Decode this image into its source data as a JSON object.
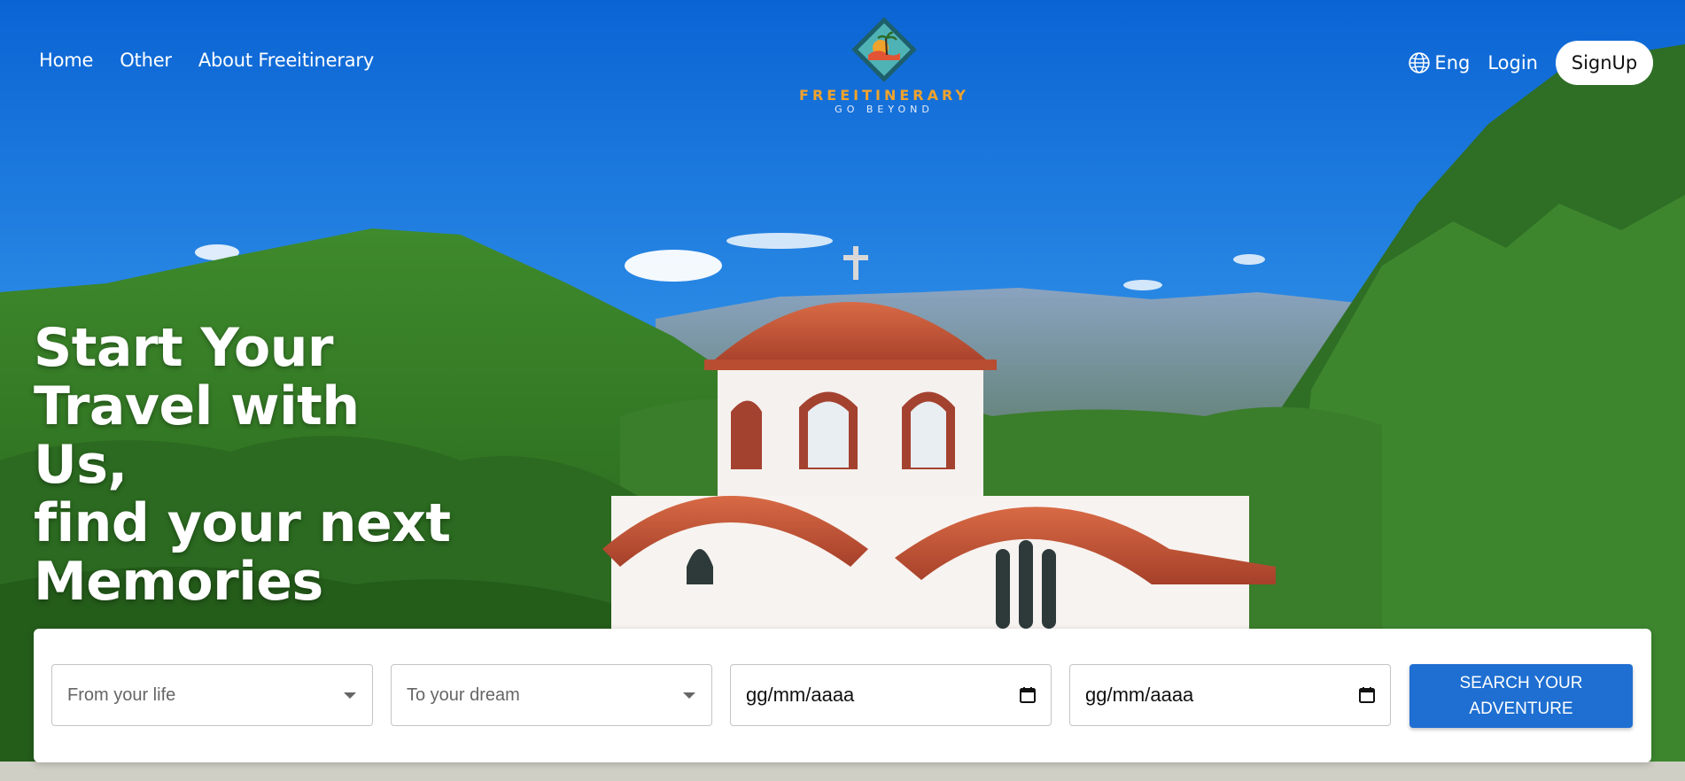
{
  "header": {
    "nav": [
      "Home",
      "Other",
      "About Freeitinerary"
    ],
    "logo": {
      "name": "FREEITINERARY",
      "tagline": "GO BEYOND"
    },
    "language": "Eng",
    "login_label": "Login",
    "signup_label": "SignUp"
  },
  "hero": {
    "headline_lines": [
      "Start Your",
      "Travel with",
      "Us,",
      "find your next",
      "Memories"
    ]
  },
  "search": {
    "from_placeholder": "From your life",
    "to_placeholder": "To your dream",
    "start_date": "gg/mm/aaaa",
    "end_date": "gg/mm/aaaa",
    "submit_label": "SEARCH YOUR ADVENTURE"
  },
  "colors": {
    "accent": "#1e6fd1",
    "logo_text": "#f0a32c",
    "sky": "#1d6fd8"
  },
  "icons": {
    "language": "globe-icon",
    "select": "chevron-down-icon",
    "date": "calendar-icon"
  }
}
